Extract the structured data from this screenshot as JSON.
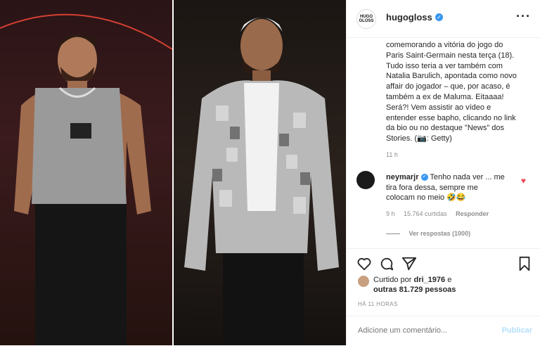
{
  "post": {
    "username": "hugogloss",
    "avatar_text": "HUGO GLOSS",
    "caption": "comemorando a vitória do jogo do Paris Saint-Germain nesta terça (18). Tudo isso teria a ver também com Natalia Barulich, apontada como novo affair do jogador – que, por acaso, é também a ex de Maluma. Eitaaaa! Será?! Vem assistir ao vídeo e entender esse bapho, clicando no link da bio ou no destaque \"News\" dos Stories. (📷: Getty)",
    "caption_time": "11 h"
  },
  "comment": {
    "username": "neymarjr",
    "text": "Tenho nada ver ... me tira fora dessa, sempre me colocam no meio 🤣😂",
    "time": "9 h",
    "likes": "15.764 curtidas",
    "reply_label": "Responder",
    "view_replies": "Ver respostas (1000)"
  },
  "likes": {
    "prefix": "Curtido por ",
    "user": "dri_1976",
    "middle": " e",
    "others": "outras 81.729 pessoas"
  },
  "date": "HÁ 11 HORAS",
  "comment_box": {
    "placeholder": "Adicione um comentário...",
    "publish_label": "Publicar"
  },
  "colors": {
    "verified": "#3897f0",
    "heart": "#ed4956",
    "publish": "#b2dffc"
  }
}
